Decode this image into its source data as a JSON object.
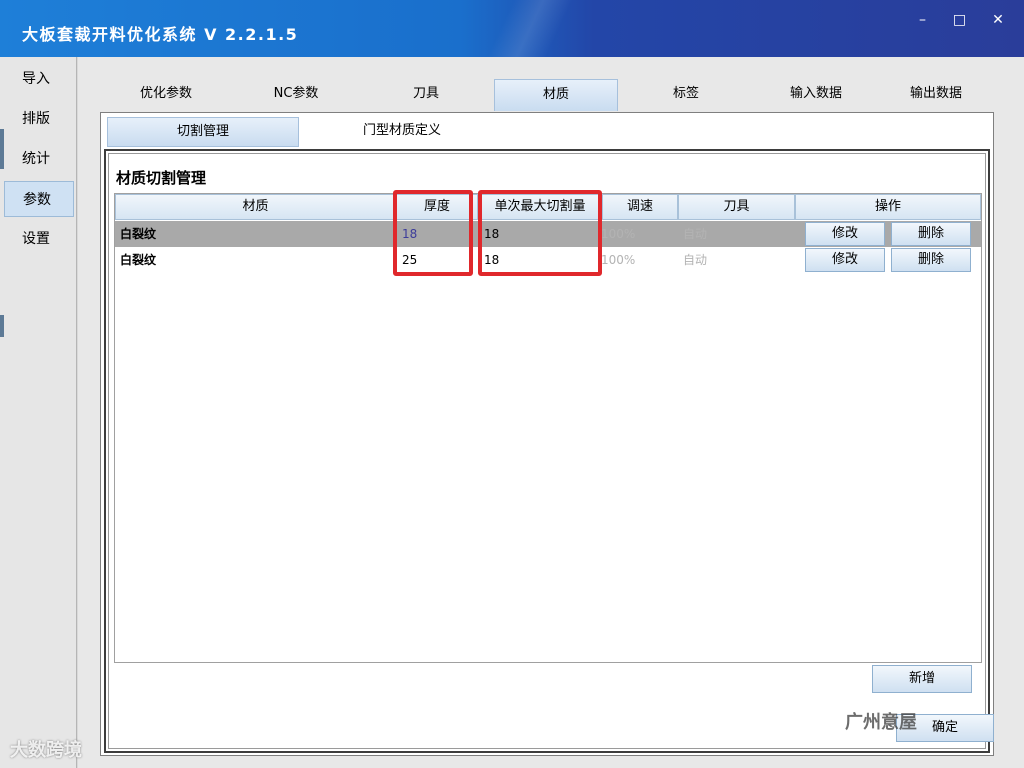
{
  "window": {
    "title": "大板套裁开料优化系统 V 2.2.1.5",
    "controls": {
      "minimize": "–",
      "maximize": "□",
      "close": "✕"
    }
  },
  "sidebar": {
    "items": [
      {
        "label": "导入"
      },
      {
        "label": "排版"
      },
      {
        "label": "统计"
      },
      {
        "label": "参数",
        "active": true
      },
      {
        "label": "设置"
      }
    ]
  },
  "tabs": [
    {
      "label": "优化参数"
    },
    {
      "label": "NC参数"
    },
    {
      "label": "刀具"
    },
    {
      "label": "材质",
      "active": true
    },
    {
      "label": "标签"
    },
    {
      "label": "输入数据"
    },
    {
      "label": "输出数据"
    }
  ],
  "subtabs": [
    {
      "label": "切割管理",
      "active": true
    },
    {
      "label": "门型材质定义"
    }
  ],
  "section": {
    "title": "材质切割管理"
  },
  "table": {
    "headers": [
      "材质",
      "厚度",
      "单次最大切割量",
      "调速",
      "刀具",
      "操作"
    ],
    "rows": [
      {
        "material": "白裂纹",
        "thickness": "18",
        "max_cut": "18",
        "speed": "100%",
        "tool": "自动",
        "edit": "修改",
        "delete": "删除",
        "selected": true
      },
      {
        "material": "白裂纹",
        "thickness": "25",
        "max_cut": "18",
        "speed": "100%",
        "tool": "自动",
        "edit": "修改",
        "delete": "删除",
        "selected": false
      }
    ]
  },
  "actions": {
    "add": "新增",
    "confirm": "确定"
  },
  "watermarks": {
    "left": "大数跨境",
    "right": "广州意屋"
  },
  "colors": {
    "titlebar": "#1e7fd8",
    "highlight": "#e0282c",
    "selected_row": "#a9a9a9"
  }
}
